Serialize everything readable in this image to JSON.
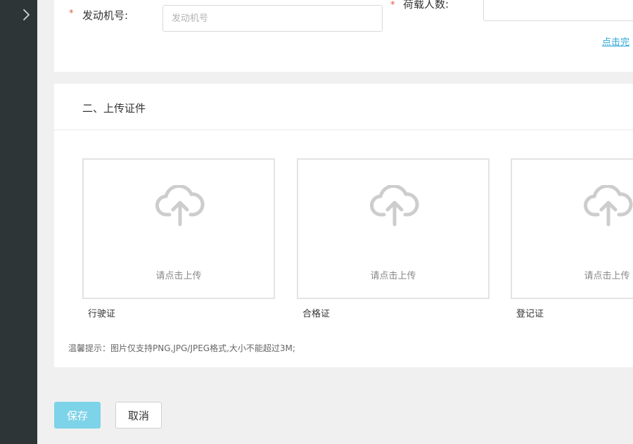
{
  "form": {
    "engine_no": {
      "required_mark": "*",
      "label": "发动机号:",
      "placeholder": "发动机号",
      "value": ""
    },
    "passenger_capacity": {
      "required_mark": "*",
      "label": "荷载人数:",
      "value": ""
    },
    "complete_link": "点击完"
  },
  "upload_section": {
    "title": "二、上传证件",
    "upload_hint": "请点击上传",
    "documents": [
      {
        "label": "行驶证"
      },
      {
        "label": "合格证"
      },
      {
        "label": "登记证"
      }
    ],
    "tip": "温馨提示：图片仅支持PNG,JPG/JPEG格式,大小不能超过3M;"
  },
  "actions": {
    "save_label": "保存",
    "cancel_label": "取消"
  },
  "colors": {
    "sidebar_bg": "#2e3537",
    "required": "#e15a4a",
    "link": "#2fa8d8",
    "save_button": "#7dd3e8",
    "page_bg": "#f0f0f0"
  },
  "icons": {
    "sidebar_toggle": "chevron-right-icon",
    "upload": "cloud-upload-icon"
  }
}
